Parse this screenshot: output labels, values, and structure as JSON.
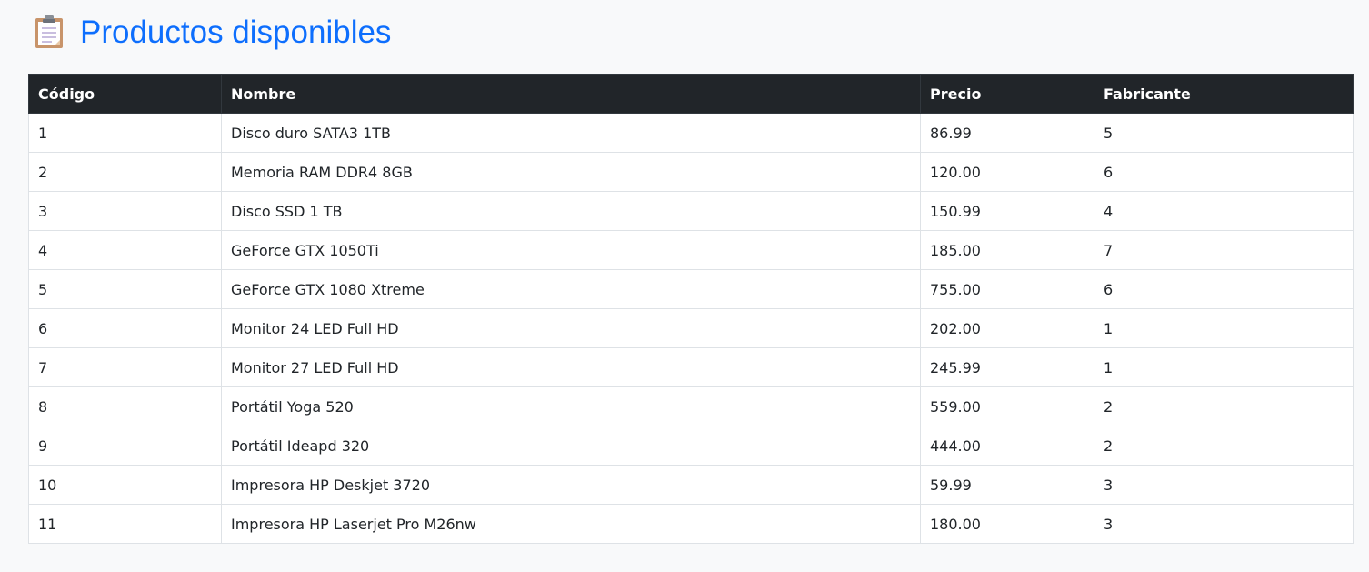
{
  "page": {
    "title": "Productos disponibles",
    "icon": "clipboard-icon",
    "accent_color": "#0d6efd"
  },
  "table": {
    "headers": [
      "Código",
      "Nombre",
      "Precio",
      "Fabricante"
    ],
    "rows": [
      [
        "1",
        "Disco duro SATA3 1TB",
        "86.99",
        "5"
      ],
      [
        "2",
        "Memoria RAM DDR4 8GB",
        "120.00",
        "6"
      ],
      [
        "3",
        "Disco SSD 1 TB",
        "150.99",
        "4"
      ],
      [
        "4",
        "GeForce GTX 1050Ti",
        "185.00",
        "7"
      ],
      [
        "5",
        "GeForce GTX 1080 Xtreme",
        "755.00",
        "6"
      ],
      [
        "6",
        "Monitor 24 LED Full HD",
        "202.00",
        "1"
      ],
      [
        "7",
        "Monitor 27 LED Full HD",
        "245.99",
        "1"
      ],
      [
        "8",
        "Portátil Yoga 520",
        "559.00",
        "2"
      ],
      [
        "9",
        "Portátil Ideapd 320",
        "444.00",
        "2"
      ],
      [
        "10",
        "Impresora HP Deskjet 3720",
        "59.99",
        "3"
      ],
      [
        "11",
        "Impresora HP Laserjet Pro M26nw",
        "180.00",
        "3"
      ]
    ]
  }
}
